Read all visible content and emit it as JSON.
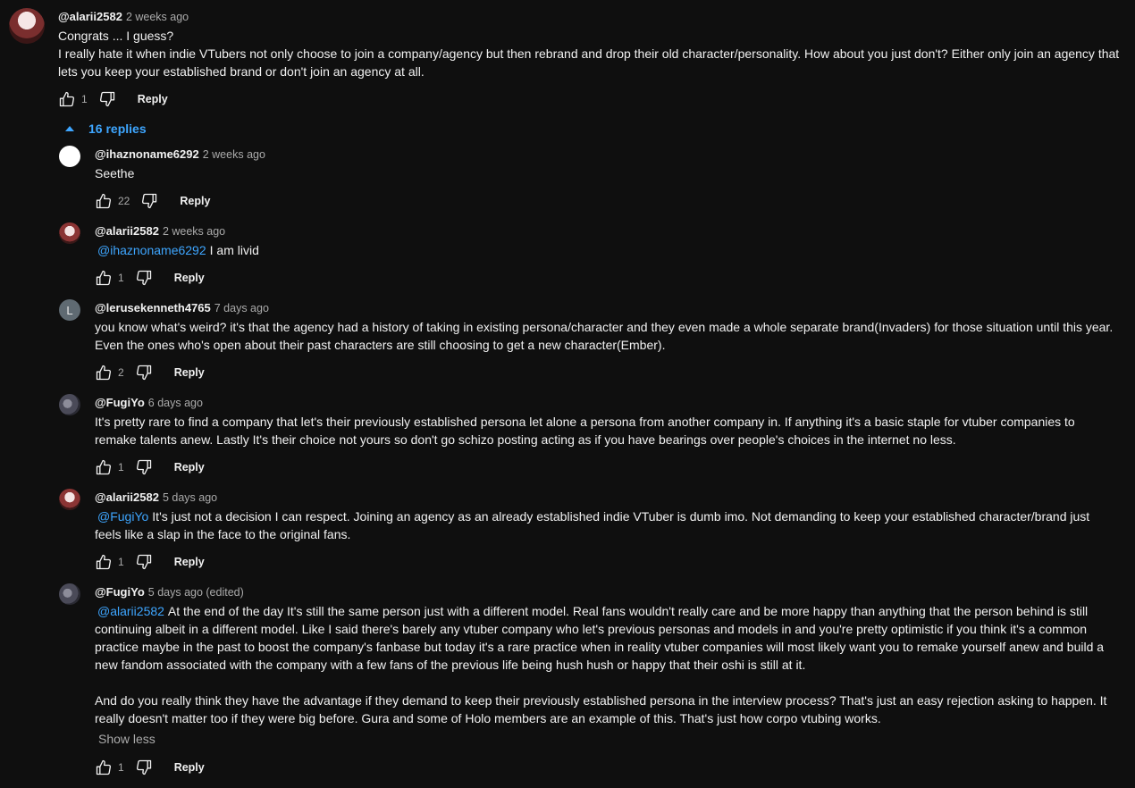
{
  "top_comment": {
    "author": "@alarii2582",
    "time": "2 weeks ago",
    "line1": "Congrats ... I guess?",
    "line2": "I really hate it when indie VTubers not only choose to join a company/agency but then rebrand and drop their old character/personality. How about you just don't? Either only join an agency that",
    "line3": "lets you keep your established brand or don't join an agency at all.",
    "likes": "1",
    "reply_label": "Reply"
  },
  "replies_toggle": "16 replies",
  "replies": [
    {
      "author": "@ihaznoname6292",
      "time": "2 weeks ago",
      "text": "Seethe",
      "likes": "22",
      "reply_label": "Reply"
    },
    {
      "author": "@alarii2582",
      "time": "2 weeks ago",
      "mention": "@ihaznoname6292",
      "text": "I am livid",
      "likes": "1",
      "reply_label": "Reply"
    },
    {
      "author": "@lerusekenneth4765",
      "time": "7 days ago",
      "avatar_letter": "L",
      "line1": "you know what's weird? it's that the agency had a history of taking in existing persona/character and they even made a whole  separate brand(Invaders) for those situation until this year.",
      "line2": "Even the ones who's open about their past characters are still choosing to get a new character(Ember).",
      "likes": "2",
      "reply_label": "Reply"
    },
    {
      "author": "@FugiYo",
      "time": "6 days ago",
      "line1": "It's pretty rare to find a company that let's their previously established persona let alone a persona from another company in. If anything it's a basic staple for vtuber companies to",
      "line2": "remake talents anew. Lastly It's their choice not yours so don't go schizo posting acting as if you have bearings over people's choices in the internet no less.",
      "likes": "1",
      "reply_label": "Reply"
    },
    {
      "author": "@alarii2582",
      "time": "5 days ago",
      "mention": "@FugiYo",
      "line1": "It's just not a decision I can respect. Joining an agency as an already established indie VTuber is dumb imo. Not demanding to keep your established character/brand just",
      "line2": "feels like a slap in the face to the original fans.",
      "likes": "1",
      "reply_label": "Reply"
    },
    {
      "author": "@FugiYo",
      "time": "5 days ago (edited)",
      "mention": "@alarii2582",
      "line1": "At the end of the day It's still the same person just with a different model. Real fans wouldn't really care and be more happy than anything that the person behind is still",
      "line2": "continuing albeit in a different model. Like I said there's barely any vtuber company who let's previous personas and models in and you're pretty optimistic if you think it's a common",
      "line3": "practice maybe in the past to boost the company's fanbase but today it's a rare practice when in reality vtuber companies will most likely want you to remake yourself anew and build a",
      "line4": "new fandom associated with the company with a few fans of the previous life being hush hush or happy that their oshi is still at it.",
      "line5": "And do you really think they have the advantage if they demand to keep their previously established persona in the interview process? That's just an easy rejection asking to happen. It",
      "line6": "really doesn't matter too if they were big before. Gura and some of Holo members are an example of this. That's just how corpo vtubing works.",
      "show_less": "Show less",
      "likes": "1",
      "reply_label": "Reply"
    }
  ]
}
